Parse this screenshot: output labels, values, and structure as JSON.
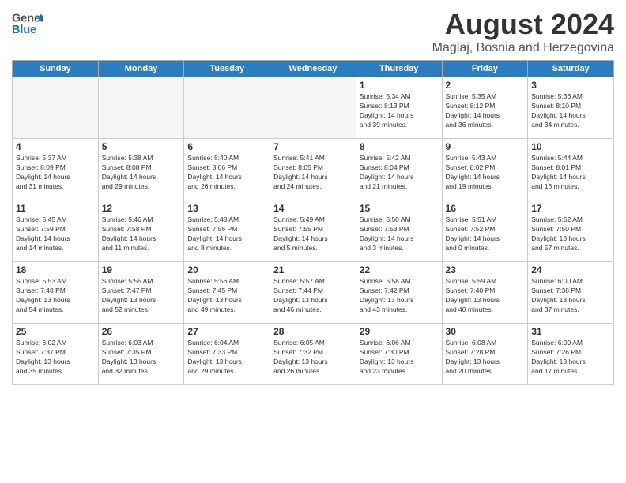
{
  "header": {
    "logo_general": "General",
    "logo_blue": "Blue",
    "month_year": "August 2024",
    "location": "Maglaj, Bosnia and Herzegovina"
  },
  "days_of_week": [
    "Sunday",
    "Monday",
    "Tuesday",
    "Wednesday",
    "Thursday",
    "Friday",
    "Saturday"
  ],
  "weeks": [
    [
      {
        "day": "",
        "info": ""
      },
      {
        "day": "",
        "info": ""
      },
      {
        "day": "",
        "info": ""
      },
      {
        "day": "",
        "info": ""
      },
      {
        "day": "1",
        "info": "Sunrise: 5:34 AM\nSunset: 8:13 PM\nDaylight: 14 hours\nand 39 minutes."
      },
      {
        "day": "2",
        "info": "Sunrise: 5:35 AM\nSunset: 8:12 PM\nDaylight: 14 hours\nand 36 minutes."
      },
      {
        "day": "3",
        "info": "Sunrise: 5:36 AM\nSunset: 8:10 PM\nDaylight: 14 hours\nand 34 minutes."
      }
    ],
    [
      {
        "day": "4",
        "info": "Sunrise: 5:37 AM\nSunset: 8:09 PM\nDaylight: 14 hours\nand 31 minutes."
      },
      {
        "day": "5",
        "info": "Sunrise: 5:38 AM\nSunset: 8:08 PM\nDaylight: 14 hours\nand 29 minutes."
      },
      {
        "day": "6",
        "info": "Sunrise: 5:40 AM\nSunset: 8:06 PM\nDaylight: 14 hours\nand 26 minutes."
      },
      {
        "day": "7",
        "info": "Sunrise: 5:41 AM\nSunset: 8:05 PM\nDaylight: 14 hours\nand 24 minutes."
      },
      {
        "day": "8",
        "info": "Sunrise: 5:42 AM\nSunset: 8:04 PM\nDaylight: 14 hours\nand 21 minutes."
      },
      {
        "day": "9",
        "info": "Sunrise: 5:43 AM\nSunset: 8:02 PM\nDaylight: 14 hours\nand 19 minutes."
      },
      {
        "day": "10",
        "info": "Sunrise: 5:44 AM\nSunset: 8:01 PM\nDaylight: 14 hours\nand 16 minutes."
      }
    ],
    [
      {
        "day": "11",
        "info": "Sunrise: 5:45 AM\nSunset: 7:59 PM\nDaylight: 14 hours\nand 14 minutes."
      },
      {
        "day": "12",
        "info": "Sunrise: 5:46 AM\nSunset: 7:58 PM\nDaylight: 14 hours\nand 11 minutes."
      },
      {
        "day": "13",
        "info": "Sunrise: 5:48 AM\nSunset: 7:56 PM\nDaylight: 14 hours\nand 8 minutes."
      },
      {
        "day": "14",
        "info": "Sunrise: 5:49 AM\nSunset: 7:55 PM\nDaylight: 14 hours\nand 5 minutes."
      },
      {
        "day": "15",
        "info": "Sunrise: 5:50 AM\nSunset: 7:53 PM\nDaylight: 14 hours\nand 3 minutes."
      },
      {
        "day": "16",
        "info": "Sunrise: 5:51 AM\nSunset: 7:52 PM\nDaylight: 14 hours\nand 0 minutes."
      },
      {
        "day": "17",
        "info": "Sunrise: 5:52 AM\nSunset: 7:50 PM\nDaylight: 13 hours\nand 57 minutes."
      }
    ],
    [
      {
        "day": "18",
        "info": "Sunrise: 5:53 AM\nSunset: 7:48 PM\nDaylight: 13 hours\nand 54 minutes."
      },
      {
        "day": "19",
        "info": "Sunrise: 5:55 AM\nSunset: 7:47 PM\nDaylight: 13 hours\nand 52 minutes."
      },
      {
        "day": "20",
        "info": "Sunrise: 5:56 AM\nSunset: 7:45 PM\nDaylight: 13 hours\nand 49 minutes."
      },
      {
        "day": "21",
        "info": "Sunrise: 5:57 AM\nSunset: 7:44 PM\nDaylight: 13 hours\nand 46 minutes."
      },
      {
        "day": "22",
        "info": "Sunrise: 5:58 AM\nSunset: 7:42 PM\nDaylight: 13 hours\nand 43 minutes."
      },
      {
        "day": "23",
        "info": "Sunrise: 5:59 AM\nSunset: 7:40 PM\nDaylight: 13 hours\nand 40 minutes."
      },
      {
        "day": "24",
        "info": "Sunrise: 6:00 AM\nSunset: 7:38 PM\nDaylight: 13 hours\nand 37 minutes."
      }
    ],
    [
      {
        "day": "25",
        "info": "Sunrise: 6:02 AM\nSunset: 7:37 PM\nDaylight: 13 hours\nand 35 minutes."
      },
      {
        "day": "26",
        "info": "Sunrise: 6:03 AM\nSunset: 7:35 PM\nDaylight: 13 hours\nand 32 minutes."
      },
      {
        "day": "27",
        "info": "Sunrise: 6:04 AM\nSunset: 7:33 PM\nDaylight: 13 hours\nand 29 minutes."
      },
      {
        "day": "28",
        "info": "Sunrise: 6:05 AM\nSunset: 7:32 PM\nDaylight: 13 hours\nand 26 minutes."
      },
      {
        "day": "29",
        "info": "Sunrise: 6:06 AM\nSunset: 7:30 PM\nDaylight: 13 hours\nand 23 minutes."
      },
      {
        "day": "30",
        "info": "Sunrise: 6:08 AM\nSunset: 7:28 PM\nDaylight: 13 hours\nand 20 minutes."
      },
      {
        "day": "31",
        "info": "Sunrise: 6:09 AM\nSunset: 7:26 PM\nDaylight: 13 hours\nand 17 minutes."
      }
    ]
  ]
}
